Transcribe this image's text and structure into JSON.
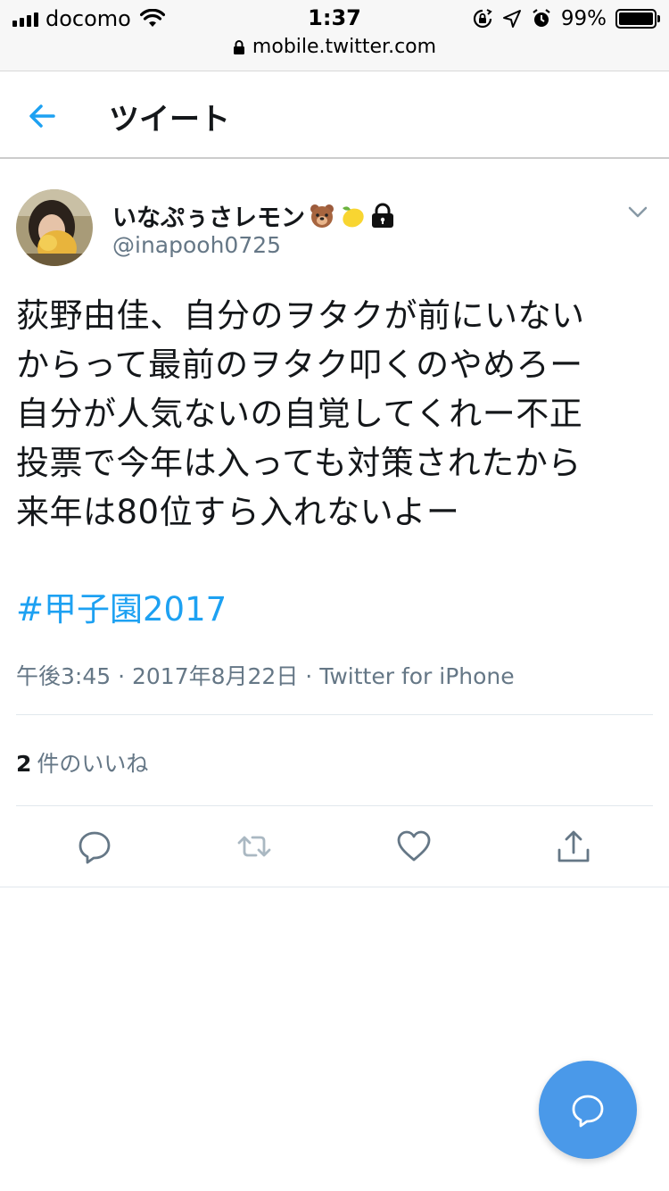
{
  "status_bar": {
    "carrier": "docomo",
    "time": "1:37",
    "battery_percent": "99%",
    "battery_level": 0.99,
    "url": "mobile.twitter.com"
  },
  "header": {
    "title": "ツイート"
  },
  "tweet": {
    "display_name": "いなぷぅさレモン",
    "name_icons": [
      "bear-face-icon",
      "lemon-icon",
      "lock-icon"
    ],
    "handle": "@inapooh0725",
    "text_lines": [
      "荻野由佳、自分のヲタクが前にいない",
      "からって最前のヲタク叩くのやめろー",
      "自分が人気ないの自覚してくれー不正",
      "投票で今年は入っても対策されたから",
      "来年は80位すら入れないよー"
    ],
    "hashtag": "#甲子園2017",
    "time": "午後3:45",
    "separator": "·",
    "date": "2017年8月22日",
    "source": "Twitter for iPhone",
    "likes_count": "2",
    "likes_label": "件のいいね"
  },
  "colors": {
    "accent": "#1da1f2",
    "fab": "#4a99e9",
    "secondary_text": "#657786",
    "icon_gray": "#657786"
  }
}
